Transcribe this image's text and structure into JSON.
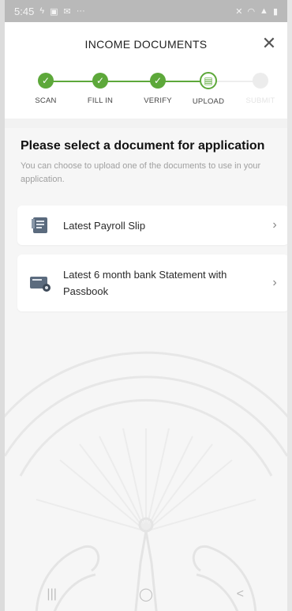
{
  "status_bar": {
    "time": "5:45",
    "left_icons": [
      "flash-icon",
      "image-icon",
      "mail-icon",
      "more-dots-icon"
    ],
    "right_icons": [
      "mute-icon",
      "wifi-icon",
      "signal-icon",
      "battery-icon"
    ]
  },
  "header": {
    "title": "INCOME DOCUMENTS",
    "close_label": "✕"
  },
  "stepper": {
    "steps": [
      {
        "label": "SCAN",
        "state": "done"
      },
      {
        "label": "FILL IN",
        "state": "done"
      },
      {
        "label": "VERIFY",
        "state": "done"
      },
      {
        "label": "UPLOAD",
        "state": "current"
      },
      {
        "label": "SUBMIT",
        "state": "future"
      }
    ],
    "colors": {
      "active": "#5da83a",
      "inactive": "#ececec"
    }
  },
  "main": {
    "heading": "Please select a document for application",
    "subtext": "You can choose to upload one of the documents to use in your application.",
    "options": [
      {
        "label": "Latest Payroll Slip",
        "icon": "payroll-slip-icon"
      },
      {
        "label": "Latest 6 month bank Statement with Passbook",
        "icon": "bank-statement-icon"
      }
    ]
  },
  "nav_bar": {
    "recent": "|||",
    "home": "◯",
    "back": "<"
  }
}
